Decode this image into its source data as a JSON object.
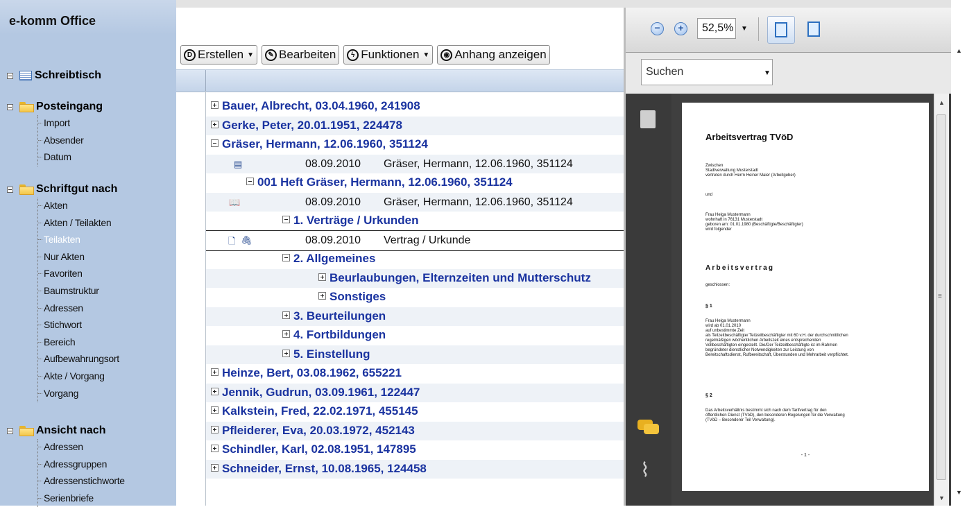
{
  "app": {
    "title": "e-komm Office"
  },
  "sidebar": {
    "sections": [
      {
        "label": "Schreibtisch",
        "items": []
      },
      {
        "label": "Posteingang",
        "items": [
          "Import",
          "Absender",
          "Datum"
        ]
      },
      {
        "label": "Schriftgut nach",
        "items": [
          "Akten",
          "Akten / Teilakten",
          "Teilakten",
          "Nur Akten",
          "Favoriten",
          "Baumstruktur",
          "Adressen",
          "Stichwort",
          "Bereich",
          "Aufbewahrungsort",
          "Akte / Vorgang",
          "Vorgang"
        ],
        "selected": "Teilakten"
      },
      {
        "label": "Ansicht nach",
        "items": [
          "Adressen",
          "Adressgruppen",
          "Adressenstichworte",
          "Serienbriefe"
        ]
      }
    ]
  },
  "toolbar": {
    "create": "Erstellen",
    "edit": "Bearbeiten",
    "functions": "Funktionen",
    "show_attachment": "Anhang anzeigen"
  },
  "tree": {
    "rows": [
      {
        "text": "Bauer, Albrecht, 03.04.1960, 241908",
        "level": 0,
        "expanded": false
      },
      {
        "text": "Gerke, Peter, 20.01.1951, 224478",
        "level": 0,
        "expanded": false
      },
      {
        "text": "Gräser, Hermann, 12.06.1960, 351124",
        "level": 0,
        "expanded": true
      },
      {
        "date": "08.09.2010",
        "desc": "Gräser, Hermann, 12.06.1960, 351124",
        "icon": "record-icon"
      },
      {
        "text": "001 Heft Gräser, Hermann, 12.06.1960, 351124",
        "level": 2,
        "expanded": true
      },
      {
        "date": "08.09.2010",
        "desc": "Gräser, Hermann, 12.06.1960, 351124",
        "icon": "book-icon"
      },
      {
        "text": "1. Verträge / Urkunden",
        "level": 3,
        "expanded": true
      },
      {
        "date": "08.09.2010",
        "desc": "Vertrag / Urkunde",
        "icon": "document-icon",
        "active": true
      },
      {
        "text": "2. Allgemeines",
        "level": 3,
        "expanded": true
      },
      {
        "text": "Beurlaubungen, Elternzeiten und Mutterschutz",
        "level": 4,
        "expanded": false
      },
      {
        "text": "Sonstiges",
        "level": 4,
        "expanded": false
      },
      {
        "text": "3. Beurteilungen",
        "level": 3,
        "expanded": false
      },
      {
        "text": "4. Fortbildungen",
        "level": 3,
        "expanded": false
      },
      {
        "text": "5. Einstellung",
        "level": 3,
        "expanded": false
      },
      {
        "text": "Heinze, Bert, 03.08.1962, 655221",
        "level": 0,
        "expanded": false
      },
      {
        "text": "Jennik, Gudrun, 03.09.1961, 122447",
        "level": 0,
        "expanded": false
      },
      {
        "text": "Kalkstein, Fred, 22.02.1971, 455145",
        "level": 0,
        "expanded": false
      },
      {
        "text": "Pfleiderer, Eva, 20.03.1972, 452143",
        "level": 0,
        "expanded": false
      },
      {
        "text": "Schindler, Karl, 02.08.1951, 147895",
        "level": 0,
        "expanded": false
      },
      {
        "text": "Schneider, Ernst, 10.08.1965, 124458",
        "level": 0,
        "expanded": false
      }
    ]
  },
  "viewer": {
    "zoom": "52,5%",
    "search_placeholder": "Suchen",
    "document": {
      "title": "Arbeitsvertrag TVöD",
      "block1": "Zwischen\nStadtverwaltung Musterstadt\nvertreten durch Herrn Heiner Maier (Arbeitgeber)",
      "und": "und",
      "block2": "Frau Helga Mustermann\nwohnhaft in 76131 Musterstadt\ngeboren am: 01.01.1980 (Beschäftigte/Beschäftigter)\nwird folgender",
      "heading": "Arbeitsvertrag",
      "geschlossen": "geschlossen:",
      "p1_head": "§ 1",
      "p1": "Frau Helga Mustermann\nwird ab 01.01.2010\nauf unbestimmte Zeit\nals Teilzeitbeschäftigte/ Teilzeitbeschäftigter mit 60 v.H. der durchschnittlichen\nregelmäßigen wöchentlichen Arbeitszeit eines entsprechenden\nVollbeschäftigten eingestellt. Die/Der Teilzeitbeschäftigte ist im Rahmen\nbegründeter dienstlicher Notwendigkeiten zur Leistung von\nBereitschaftsdienst, Rufbereitschaft, Überstunden und Mehrarbeit verpflichtet.",
      "p2_head": "§ 2",
      "p2": "Das Arbeitsverhältnis bestimmt sich nach dem Tarifvertrag für den\nöffentlichen Dienst (TVöD), den besonderen Regelungen für die Verwaltung\n(TVöD – Besonderer Teil Verwaltung).",
      "page_number": "- 1 -"
    }
  }
}
